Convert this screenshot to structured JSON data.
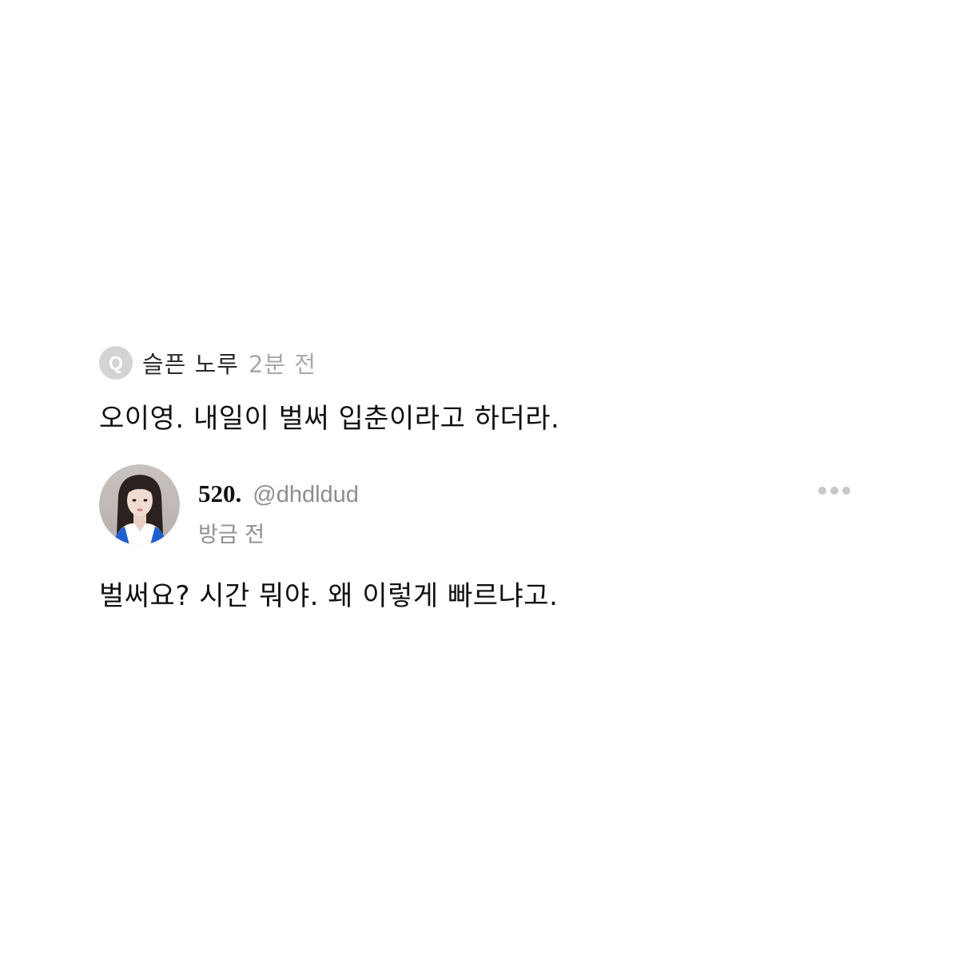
{
  "question": {
    "icon_letter": "Q",
    "icon": "q-circle-icon",
    "author": "슬픈 노루",
    "time": "2분 전",
    "body": "오이영. 내일이 벌써 입춘이라고 하더라."
  },
  "reply": {
    "avatar": "profile-photo",
    "name": "520.",
    "handle": "@dhdldud",
    "time": "방금 전",
    "more_icon": "more-horizontal-icon",
    "body": "벌써요? 시간 뭐야. 왜 이렇게 빠르냐고."
  },
  "colors": {
    "background": "#ffffff",
    "text": "#111111",
    "muted": "#8e8e8e",
    "icon_gray": "#d4d4d4"
  }
}
